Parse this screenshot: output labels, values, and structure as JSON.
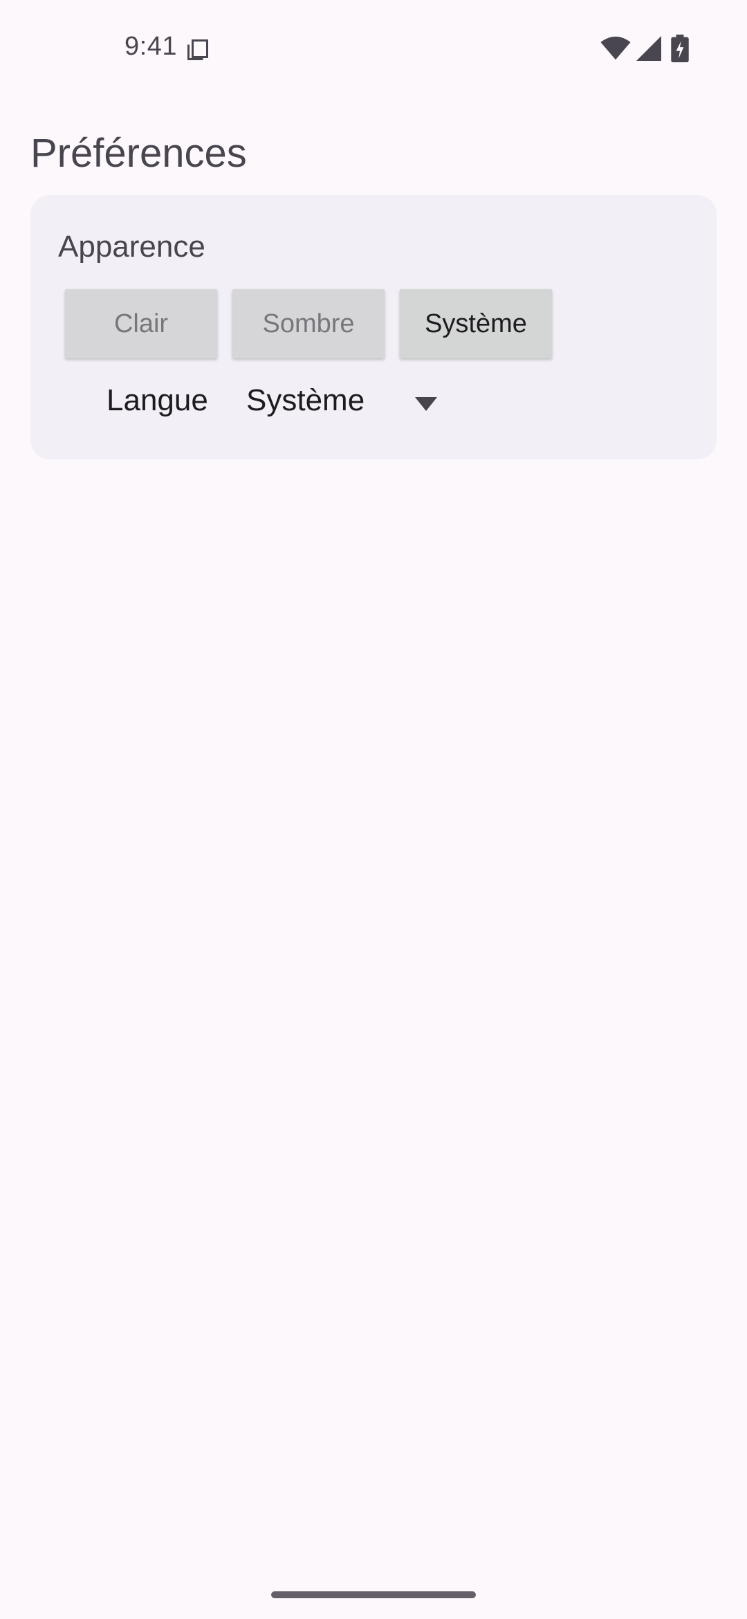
{
  "status_bar": {
    "time": "9:41",
    "icons": [
      "clipboard-icon",
      "wifi-icon",
      "signal-icon",
      "battery-charging-icon"
    ]
  },
  "page": {
    "title": "Préférences"
  },
  "appearance": {
    "section_title": "Apparence",
    "options": [
      "Clair",
      "Sombre",
      "Système"
    ],
    "selected": "Système"
  },
  "language": {
    "label": "Langue",
    "value": "Système"
  },
  "colors": {
    "background": "#fdf8fc",
    "card": "#f2f0f6",
    "button": "#d6d6d8",
    "text_primary": "#1d1b20",
    "text_secondary": "#49454f"
  }
}
